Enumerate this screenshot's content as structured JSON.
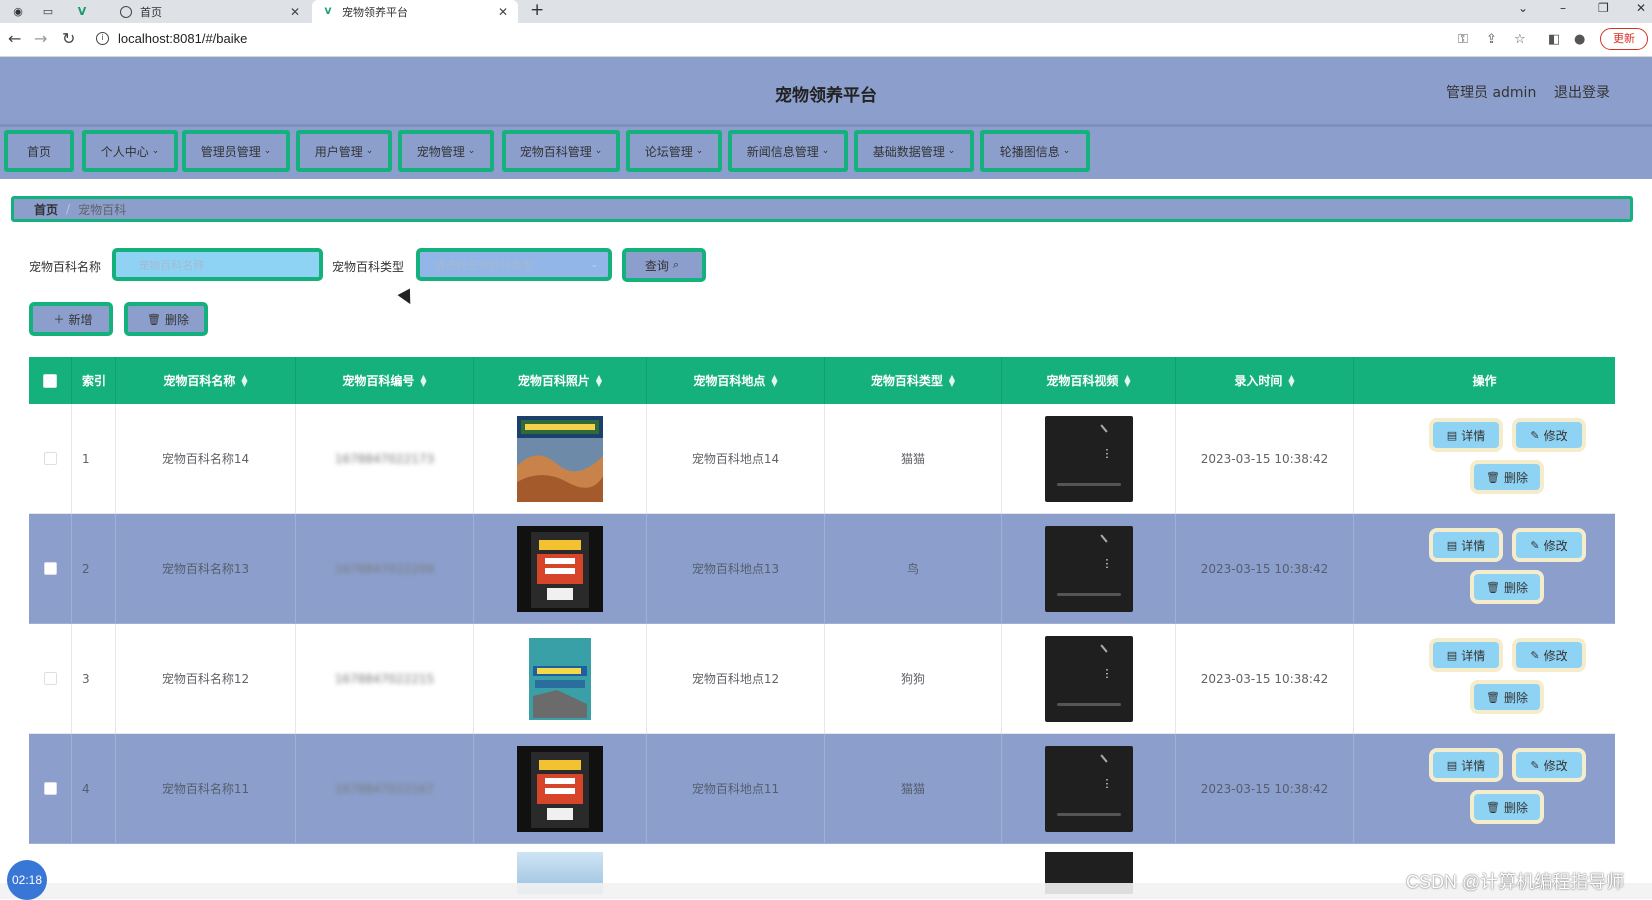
{
  "browser": {
    "tabs": [
      {
        "label": "首页",
        "active": false
      },
      {
        "label": "宠物领养平台",
        "active": true
      }
    ],
    "url": "localhost:8081/#/baike",
    "update_label": "更新"
  },
  "header": {
    "title": "宠物领养平台",
    "user_label": "管理员 admin",
    "logout_label": "退出登录"
  },
  "nav": [
    {
      "label": "首页",
      "dropdown": false
    },
    {
      "label": "个人中心",
      "dropdown": true
    },
    {
      "label": "管理员管理",
      "dropdown": true
    },
    {
      "label": "用户管理",
      "dropdown": true
    },
    {
      "label": "宠物管理",
      "dropdown": true
    },
    {
      "label": "宠物百科管理",
      "dropdown": true
    },
    {
      "label": "论坛管理",
      "dropdown": true
    },
    {
      "label": "新闻信息管理",
      "dropdown": true
    },
    {
      "label": "基础数据管理",
      "dropdown": true
    },
    {
      "label": "轮播图信息",
      "dropdown": true
    }
  ],
  "breadcrumb": {
    "home": "首页",
    "current": "宠物百科"
  },
  "search": {
    "name_label": "宠物百科名称",
    "name_placeholder": "宠物百科名称",
    "type_label": "宠物百科类型",
    "type_placeholder": "请选择宠物百科类型",
    "query_label": "查询"
  },
  "actions": {
    "add_label": "新增",
    "delete_label": "删除"
  },
  "table": {
    "columns": [
      "索引",
      "宠物百科名称",
      "宠物百科编号",
      "宠物百科照片",
      "宠物百科地点",
      "宠物百科类型",
      "宠物百科视频",
      "录入时间",
      "操作"
    ],
    "rows": [
      {
        "index": "1",
        "name": "宠物百科名称14",
        "code": "1678847022173",
        "place": "宠物百科地点14",
        "type": "猫猫",
        "time": "2023-03-15 10:38:42",
        "photo": "desert"
      },
      {
        "index": "2",
        "name": "宠物百科名称13",
        "code": "1678847022209",
        "place": "宠物百科地点13",
        "type": "鸟",
        "time": "2023-03-15 10:38:42",
        "photo": "book-red"
      },
      {
        "index": "3",
        "name": "宠物百科名称12",
        "code": "1678847022215",
        "place": "宠物百科地点12",
        "type": "狗狗",
        "time": "2023-03-15 10:38:42",
        "photo": "book-teal"
      },
      {
        "index": "4",
        "name": "宠物百科名称11",
        "code": "1678847022167",
        "place": "宠物百科地点11",
        "type": "猫猫",
        "time": "2023-03-15 10:38:42",
        "photo": "book-red"
      }
    ],
    "op_detail": "详情",
    "op_edit": "修改",
    "op_delete": "删除"
  },
  "overlay": {
    "timer": "02:18",
    "watermark": "CSDN @计算机编程指导师"
  },
  "colors": {
    "accent": "#15b17c",
    "header_bg": "#8c9fcc",
    "button_bg": "#8fd3f4",
    "op_border": "#f4eccb"
  }
}
